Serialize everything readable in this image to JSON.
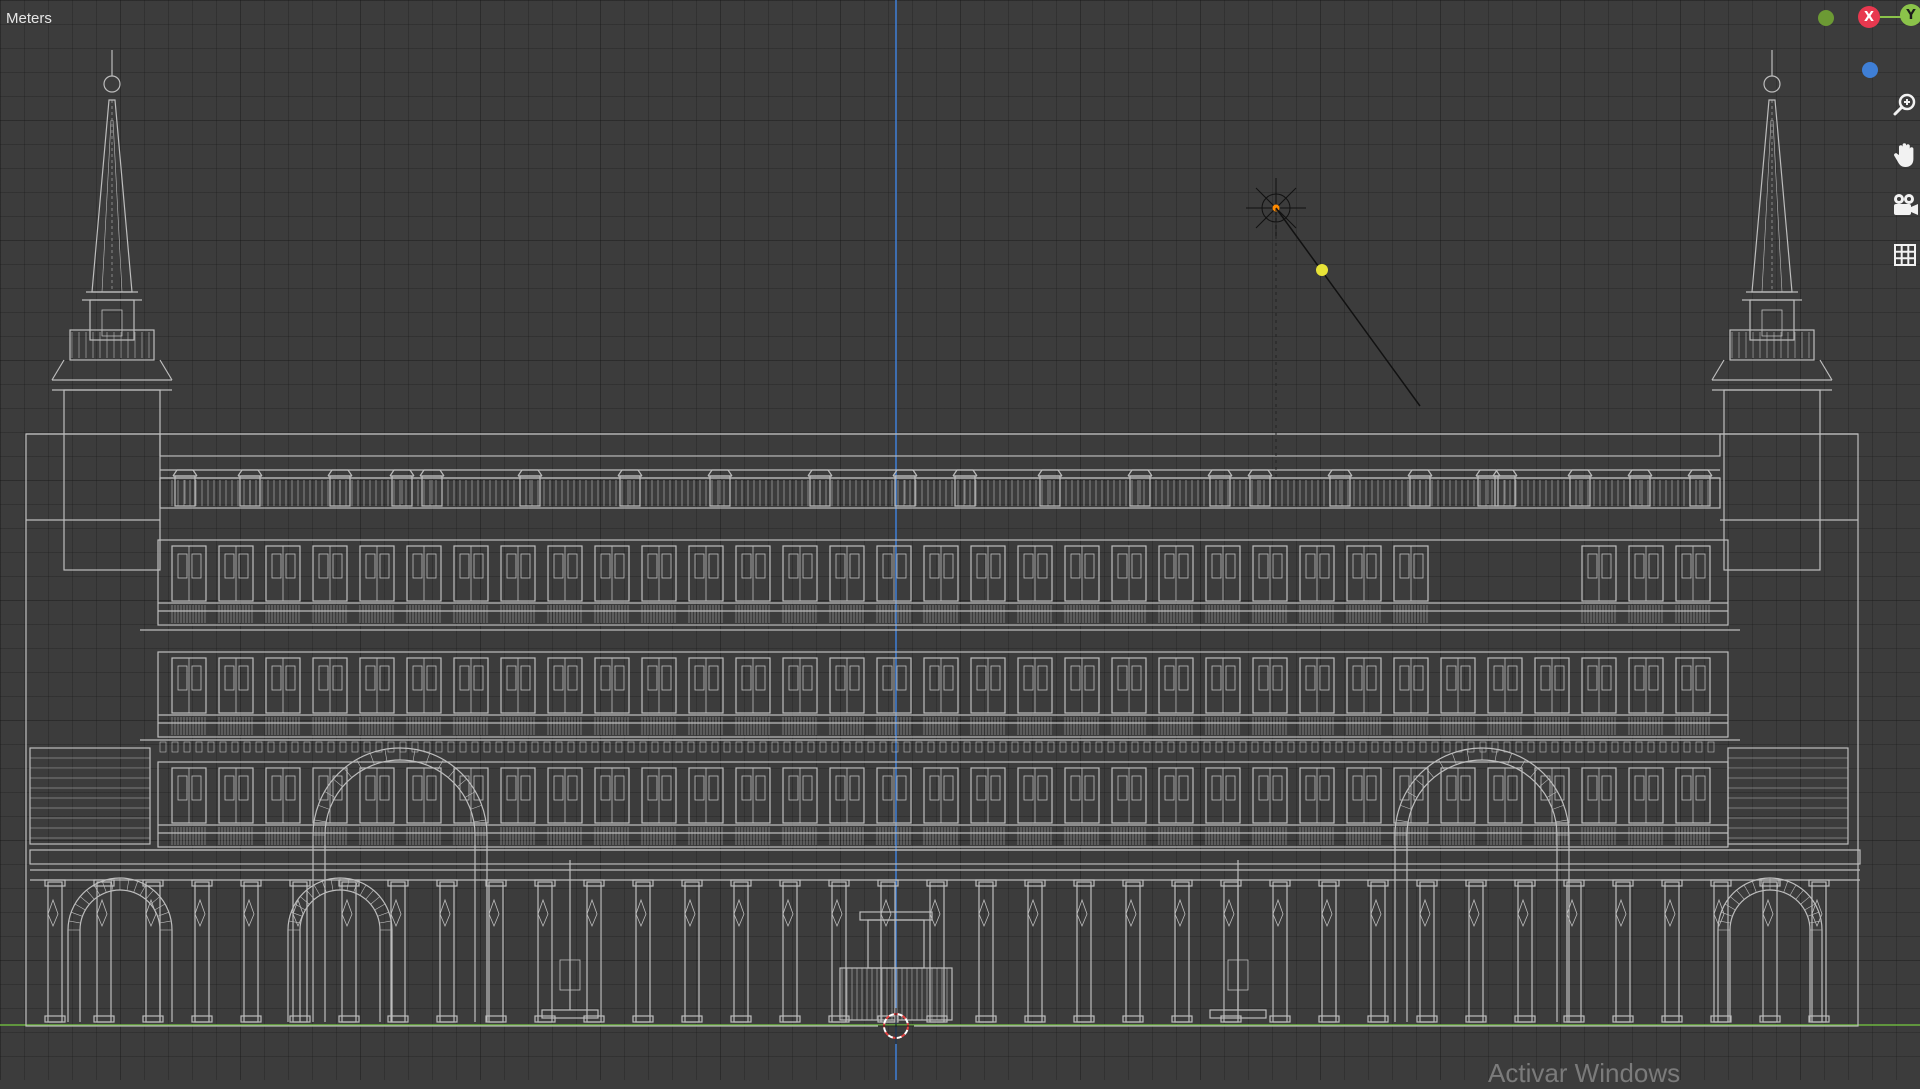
{
  "viewport": {
    "units_label": "Meters",
    "background_color": "#3c3c3c",
    "grid_color": "#2f2f2f",
    "wire_color": "#bdbdbd",
    "z_axis_color": "#3f7fd6",
    "ground_axis_color": "#6cb33e"
  },
  "gizmo": {
    "x_label": "X",
    "y_label": "Y",
    "x_color": "#e8384f",
    "y_color": "#8bc34a",
    "z_color": "#3f7fd6"
  },
  "navigation_tools": [
    {
      "name": "zoom-icon"
    },
    {
      "name": "pan-hand-icon"
    },
    {
      "name": "camera-icon"
    },
    {
      "name": "grid-toggle-icon"
    }
  ],
  "watermark": "Activar Windows"
}
